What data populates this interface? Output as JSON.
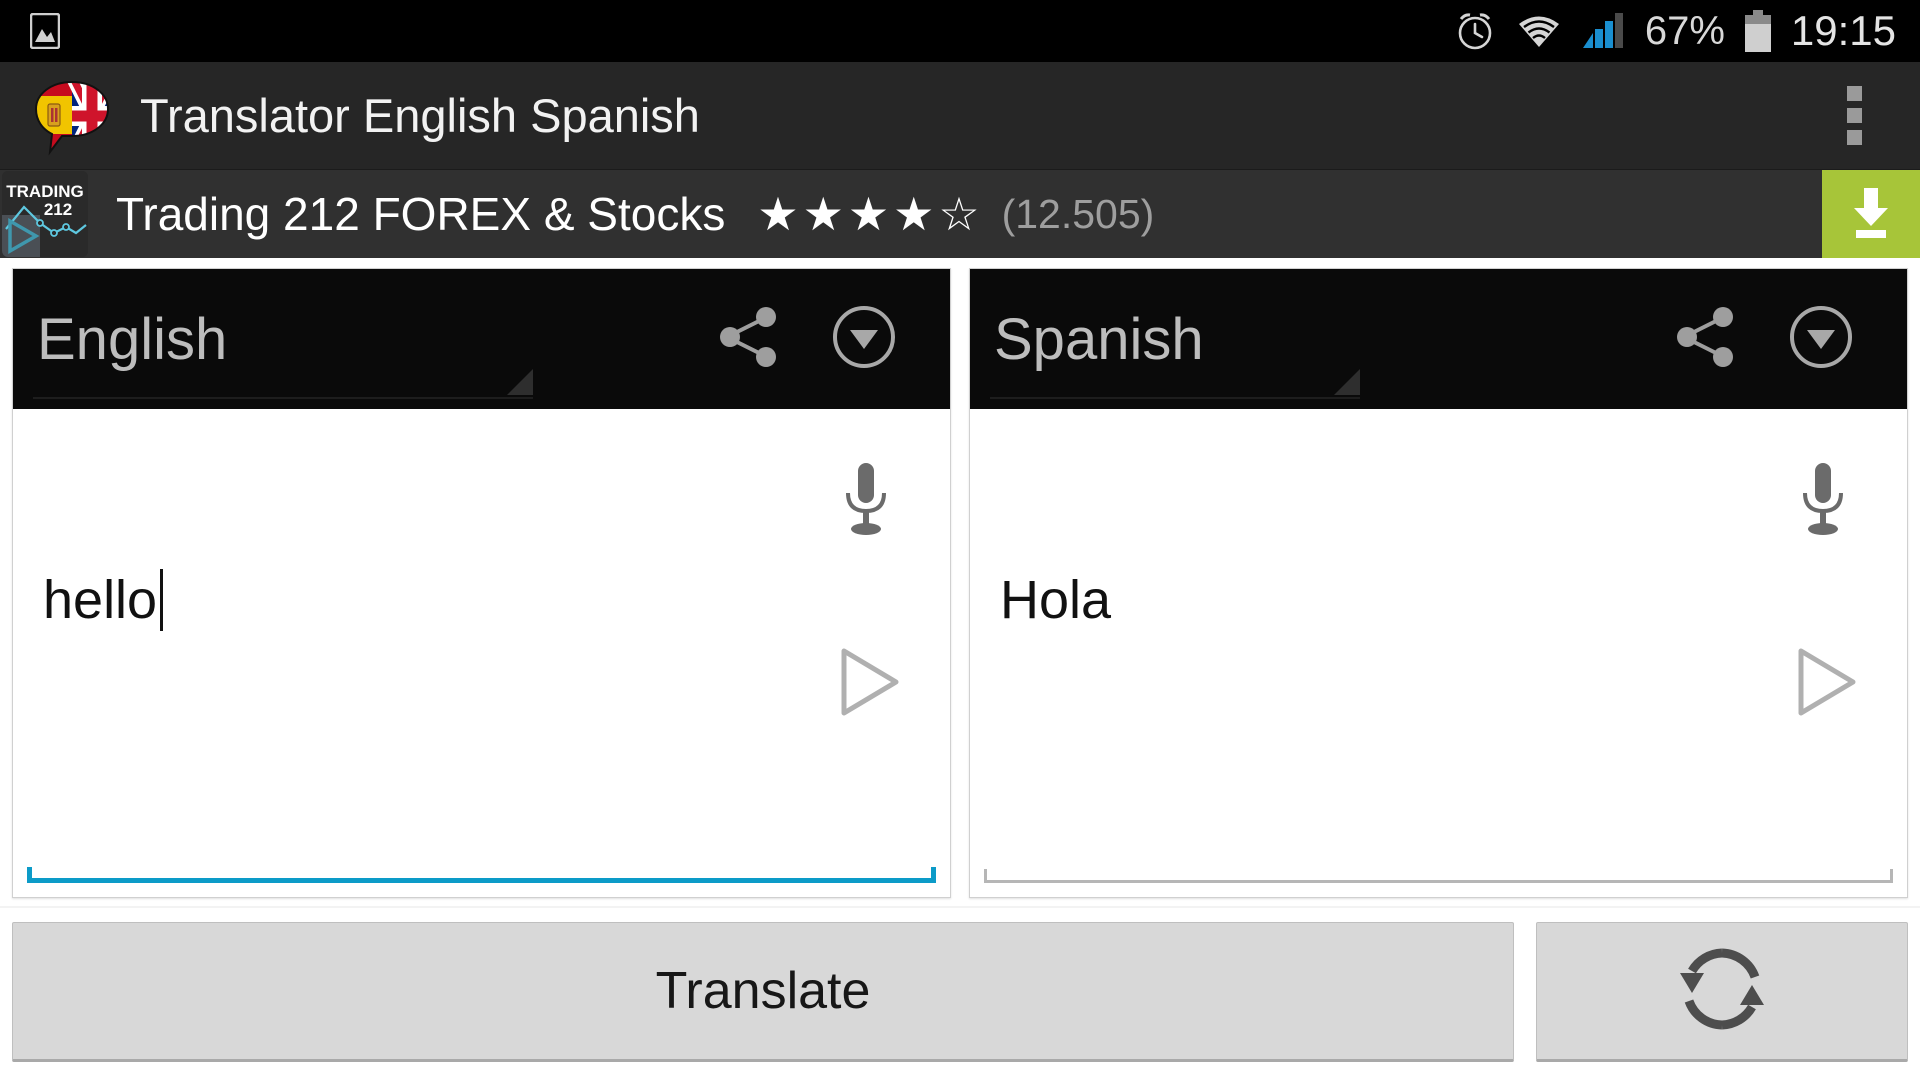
{
  "status_bar": {
    "screenshot_icon": "image-icon",
    "alarm_icon": "alarm-clock-icon",
    "wifi_icon": "wifi-icon",
    "signal_icon": "cellular-signal-icon",
    "battery_percent": "67%",
    "battery_icon": "battery-icon",
    "clock": "19:15"
  },
  "action_bar": {
    "app_icon": "app-flag-bubble-icon",
    "title": "Translator English Spanish",
    "overflow_icon": "overflow-menu-icon"
  },
  "ad_banner": {
    "icon_label_top": "TRADING",
    "icon_label_bottom": "212",
    "title": "Trading 212 FOREX & Stocks",
    "stars_filled": 4,
    "stars_total": 5,
    "star_filled_glyph": "★",
    "star_empty_glyph": "☆",
    "rating_count": "(12.505)",
    "install_icon": "download-icon",
    "install_color": "#a7c539",
    "background_color": "#303030"
  },
  "panels": [
    {
      "language": "English",
      "share_icon": "share-icon",
      "dropdown_icon": "chevron-down-circle-icon",
      "mic_icon": "microphone-icon",
      "play_icon": "play-icon",
      "text": "hello",
      "placeholder": "",
      "focused": true,
      "underline_color": "#0c9bc8",
      "has_caret": true
    },
    {
      "language": "Spanish",
      "share_icon": "share-icon",
      "dropdown_icon": "chevron-down-circle-icon",
      "mic_icon": "microphone-icon",
      "play_icon": "play-icon",
      "text": "Hola",
      "placeholder": "",
      "focused": false,
      "underline_color": "#b6b6b6",
      "has_caret": false
    }
  ],
  "bottom_bar": {
    "translate_label": "Translate",
    "swap_icon": "swap-languages-icon"
  }
}
